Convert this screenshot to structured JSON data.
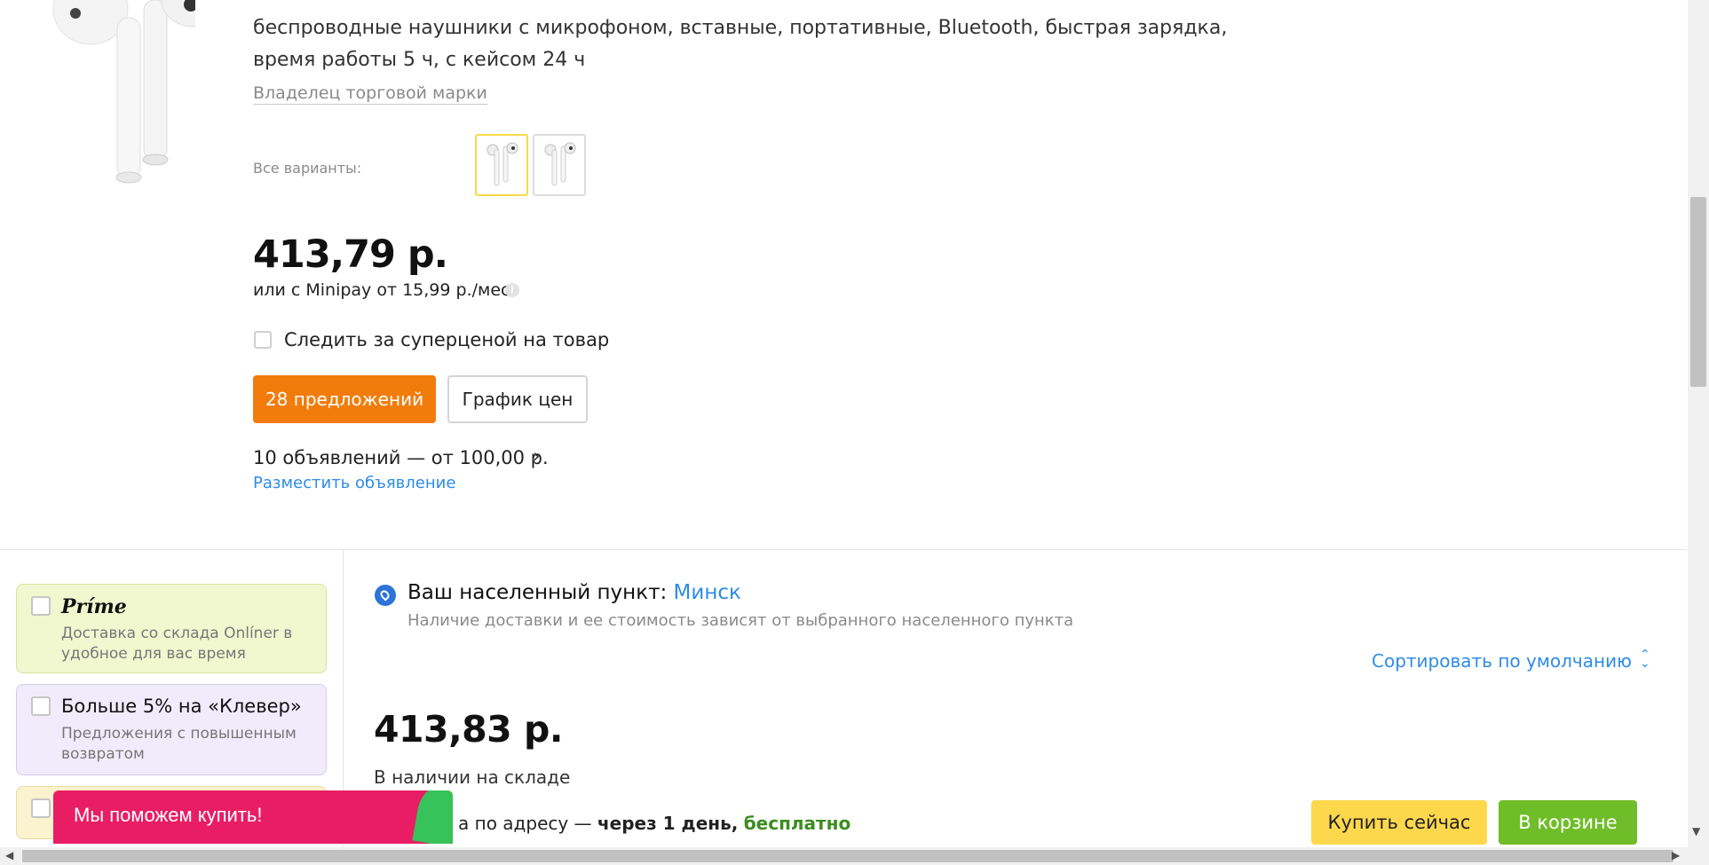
{
  "product": {
    "description": "беспроводные наушники с микрофоном, вставные, портативные, Bluetooth, быстрая зарядка, время работы 5 ч, с кейсом 24 ч",
    "brand_owner_link": "Владелец торговой марки",
    "variants_label": "Все варианты:",
    "price": "413,79 р.",
    "minipay": "или с Minipay от 15,99 р./мес.",
    "info_glyph": "i",
    "track_label": "Следить за суперценой на товар",
    "offers_button": "28 предложений",
    "price_chart_button": "График цен",
    "ads_text": "10 объявлений — от 100,00 р.",
    "ads_chevron": "›",
    "place_ad_link": "Разместить объявление"
  },
  "filters": {
    "prime": {
      "title": "Príme",
      "subtitle": "Доставка со склада Onlíner в удобное для вас время"
    },
    "clever": {
      "title": "Больше 5% на «Клевер»",
      "subtitle": "Предложения с повышенным возвратом"
    }
  },
  "help_banner": {
    "text": "Мы поможем купить!"
  },
  "location": {
    "label": "Ваш населенный пункт:",
    "city": "Минск",
    "note": "Наличие доставки и ее стоимость зависят от выбранного населенного пункта"
  },
  "sort": {
    "label": "Сортировать по умолчанию",
    "icon_glyph": "⌃⌄"
  },
  "offer": {
    "price": "413,83 р.",
    "stock": "В наличии на складе",
    "delivery_prefix": "а по адресу —",
    "delivery_time": "через 1 день,",
    "delivery_cost": "бесплатно",
    "buy_now_button": "Купить сейчас",
    "in_cart_button": "В корзине"
  },
  "scrollbar": {
    "down_arrow": "▼",
    "left_arrow": "◀",
    "right_arrow": "▶"
  },
  "colors": {
    "accent_orange": "#f27c0b",
    "link_blue": "#2d8be8",
    "buy_yellow": "#fdd84d",
    "cart_green": "#6fbd28",
    "banner_pink": "#e91d63"
  }
}
